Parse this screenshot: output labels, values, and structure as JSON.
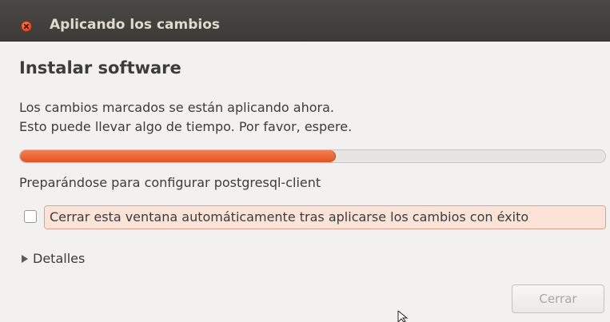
{
  "window": {
    "title": "Aplicando los cambios"
  },
  "main": {
    "heading": "Instalar software",
    "description_line1": "Los cambios marcados se están aplicando ahora.",
    "description_line2": "Esto puede llevar algo de tiempo. Por favor, espere.",
    "progress_fraction": 0.54,
    "status_text": "Preparándose para configurar postgresql-client",
    "auto_close_checkbox": {
      "label": "Cerrar esta ventana automáticamente tras aplicarse los cambios con éxito",
      "checked": false
    },
    "details_expander_label": "Detalles"
  },
  "footer": {
    "close_button_label": "Cerrar",
    "close_button_enabled": false
  },
  "colors": {
    "titlebar": "#3c3b37",
    "accent": "#e5541f",
    "window_bg": "#f2f1f0"
  },
  "icons": {
    "close": "close-icon",
    "expander": "triangle-right-icon"
  }
}
